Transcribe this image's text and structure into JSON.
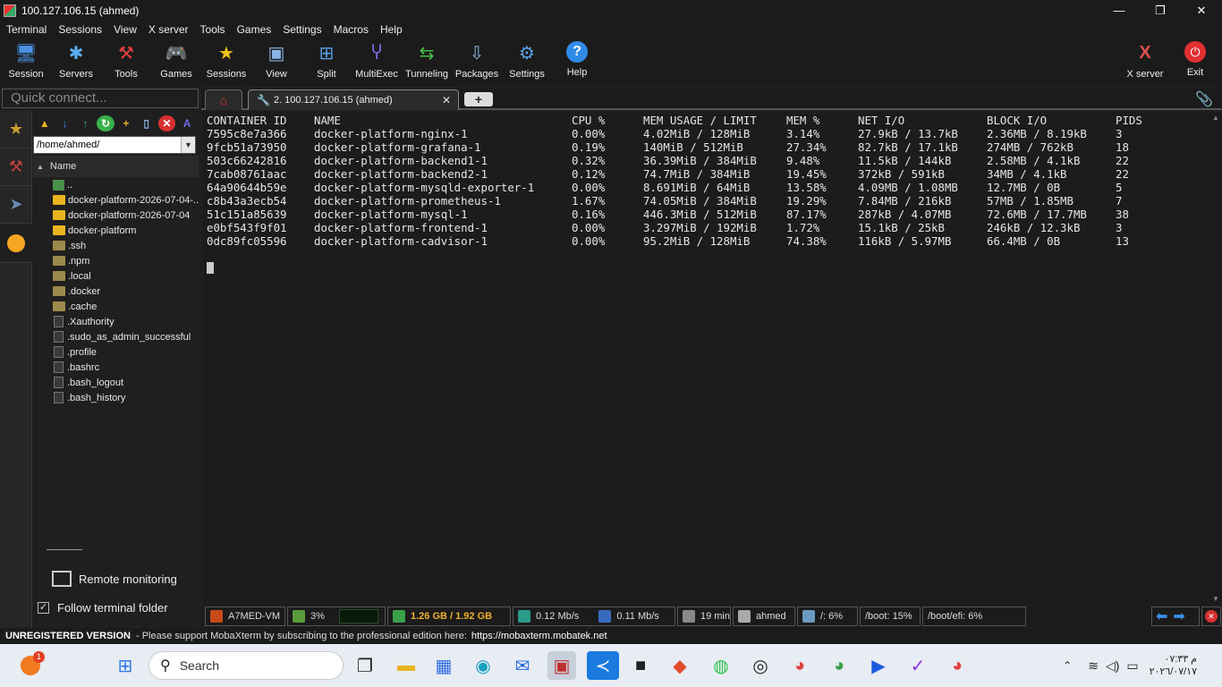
{
  "window": {
    "title": "100.127.106.15 (ahmed)",
    "controls": [
      "—",
      "❐",
      "✕"
    ]
  },
  "menu": [
    "Terminal",
    "Sessions",
    "View",
    "X server",
    "Tools",
    "Games",
    "Settings",
    "Macros",
    "Help"
  ],
  "toolbar": {
    "buttons": [
      "Session",
      "Servers",
      "Tools",
      "Games",
      "Sessions",
      "View",
      "Split",
      "MultiExec",
      "Tunneling",
      "Packages",
      "Settings",
      "Help"
    ],
    "right_buttons": [
      "X server",
      "Exit"
    ]
  },
  "quick_connect": {
    "placeholder": "Quick connect..."
  },
  "sftp": {
    "path": "/home/ahmed/",
    "column": "Name",
    "items": [
      {
        "name": "..",
        "type": "up"
      },
      {
        "name": "docker-platform-2026-07-04-...",
        "type": "folder"
      },
      {
        "name": "docker-platform-2026-07-04",
        "type": "folder"
      },
      {
        "name": "docker-platform",
        "type": "folder"
      },
      {
        "name": ".ssh",
        "type": "folder-dim"
      },
      {
        "name": ".npm",
        "type": "folder-dim"
      },
      {
        "name": ".local",
        "type": "folder-dim"
      },
      {
        "name": ".docker",
        "type": "folder-dim"
      },
      {
        "name": ".cache",
        "type": "folder-dim"
      },
      {
        "name": ".Xauthority",
        "type": "file"
      },
      {
        "name": ".sudo_as_admin_successful",
        "type": "file"
      },
      {
        "name": ".profile",
        "type": "file"
      },
      {
        "name": ".bashrc",
        "type": "file"
      },
      {
        "name": ".bash_logout",
        "type": "file"
      },
      {
        "name": ".bash_history",
        "type": "file"
      }
    ],
    "remote_monitoring": "Remote monitoring",
    "follow_folder": "Follow terminal folder"
  },
  "tabs": {
    "session": "2. 100.127.106.15 (ahmed)",
    "new": "+"
  },
  "terminal": {
    "headers": [
      "CONTAINER ID",
      "NAME",
      "CPU %",
      "MEM USAGE / LIMIT",
      "MEM %",
      "NET I/O",
      "BLOCK I/O",
      "PIDS"
    ],
    "rows": [
      [
        "7595c8e7a366",
        "docker-platform-nginx-1",
        "0.00%",
        "4.02MiB / 128MiB",
        "3.14%",
        "27.9kB / 13.7kB",
        "2.36MB / 8.19kB",
        "3"
      ],
      [
        "9fcb51a73950",
        "docker-platform-grafana-1",
        "0.19%",
        "140MiB / 512MiB",
        "27.34%",
        "82.7kB / 17.1kB",
        "274MB / 762kB",
        "18"
      ],
      [
        "503c66242816",
        "docker-platform-backend1-1",
        "0.32%",
        "36.39MiB / 384MiB",
        "9.48%",
        "11.5kB / 144kB",
        "2.58MB / 4.1kB",
        "22"
      ],
      [
        "7cab08761aac",
        "docker-platform-backend2-1",
        "0.12%",
        "74.7MiB / 384MiB",
        "19.45%",
        "372kB / 591kB",
        "34MB / 4.1kB",
        "22"
      ],
      [
        "64a90644b59e",
        "docker-platform-mysqld-exporter-1",
        "0.00%",
        "8.691MiB / 64MiB",
        "13.58%",
        "4.09MB / 1.08MB",
        "12.7MB / 0B",
        "5"
      ],
      [
        "c8b43a3ecb54",
        "docker-platform-prometheus-1",
        "1.67%",
        "74.05MiB / 384MiB",
        "19.29%",
        "7.84MB / 216kB",
        "57MB / 1.85MB",
        "7"
      ],
      [
        "51c151a85639",
        "docker-platform-mysql-1",
        "0.16%",
        "446.3MiB / 512MiB",
        "87.17%",
        "287kB / 4.07MB",
        "72.6MB / 17.7MB",
        "38"
      ],
      [
        "e0bf543f9f01",
        "docker-platform-frontend-1",
        "0.00%",
        "3.297MiB / 192MiB",
        "1.72%",
        "15.1kB / 25kB",
        "246kB / 12.3kB",
        "3"
      ],
      [
        "0dc89fc05596",
        "docker-platform-cadvisor-1",
        "0.00%",
        "95.2MiB / 128MiB",
        "74.38%",
        "116kB / 5.97MB",
        "66.4MB / 0B",
        "13"
      ]
    ]
  },
  "status": {
    "host": "A7MED-VM",
    "cpu": "3%",
    "mem": "1.26 GB / 1.92 GB",
    "up": "0.12 Mb/s",
    "down": "0.11 Mb/s",
    "uptime": "19 min",
    "user": "ahmed",
    "disk_root": "/: 6%",
    "disk_boot": "/boot: 15%",
    "disk_efi": "/boot/efi: 6%"
  },
  "unregistered": {
    "label": "UNREGISTERED VERSION",
    "message": "-  Please support MobaXterm by subscribing to the professional edition here:",
    "link": "https://mobaxterm.mobatek.net"
  },
  "taskbar": {
    "search": "Search",
    "notification_count": "1",
    "time": "م ٠٧:٣٣",
    "date": "٢٠٢٦/٠٧/١٧"
  }
}
